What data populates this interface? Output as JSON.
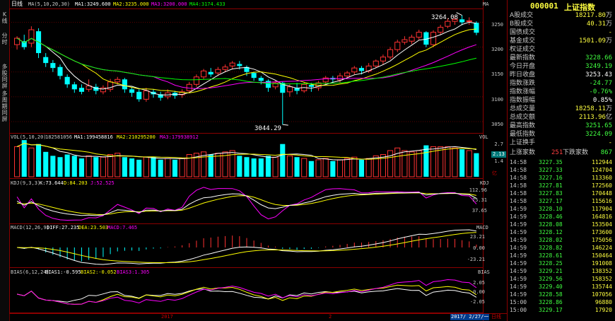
{
  "sidebar": {
    "tabs": [
      {
        "label": "K线",
        "active": true
      },
      {
        "label": "分时",
        "active": false
      },
      {
        "label": "多股同屏",
        "active": false
      },
      {
        "label": "多周期同屏",
        "active": false
      }
    ]
  },
  "main": {
    "period": "日线",
    "ma_legend": {
      "name": "MA(5,10,20,30)",
      "ma1": "MA1:3249.600",
      "ma2": "MA2:3235.000",
      "ma3": "MA3:3200.000",
      "ma4": "MA4:3174.433"
    },
    "price_axis": [
      "3250",
      "3200",
      "3150",
      "3100",
      "3050"
    ],
    "high_marker": "3264.08",
    "low_marker": "3044.29",
    "corner_label": "MA",
    "vol": {
      "name": "VOL(5,10,20)",
      "value": "182581056",
      "ma1": "MA1:199458816",
      "ma2": "MA2:210295200",
      "ma3": "MA3:179938912",
      "tag": "VOL",
      "axis": [
        "2.7",
        "1.4"
      ],
      "current": "2.13",
      "unit": "亿"
    },
    "kdj": {
      "name": "KDJ(9,3,3)",
      "k": "K:73.644",
      "d": "D:84.203",
      "j": "J:52.525",
      "tag": "KDJ",
      "axis": [
        "112.96",
        "75.31",
        "37.65"
      ]
    },
    "macd": {
      "name": "MACD(12,26,9)",
      "diff": "DIFF:27.235",
      "dea": "DEA:23.503",
      "macd": "MACD:7.465",
      "tag": "MACD",
      "axis": [
        "23.21",
        "0.00",
        "-23.21"
      ]
    },
    "bias": {
      "name": "BIAS(6,12,24)",
      "b1": "BIAS1:-0.595",
      "b2": "BIAS2:-0.052",
      "b3": "BIAS3:1.305",
      "tag": "BIAS",
      "axis": [
        "2.05",
        "0.00",
        "-2.05"
      ]
    },
    "xaxis": {
      "year": "2017",
      "month": "2",
      "date": "2017/ 2/27/一",
      "period_tag": "日线"
    }
  },
  "quote": {
    "code": "000001",
    "name": "上证指数",
    "rows": [
      {
        "label": "A股成交",
        "value": "18217.80",
        "unit": "万",
        "color": "#ffff40"
      },
      {
        "label": "B股成交",
        "value": "40.31",
        "unit": "万",
        "color": "#ffff40"
      },
      {
        "label": "国债成交",
        "value": "-",
        "unit": "",
        "color": "#ffff40"
      },
      {
        "label": "基金成交",
        "value": "1501.09",
        "unit": "万",
        "color": "#ffff40"
      },
      {
        "label": "权证成交",
        "value": "",
        "unit": "",
        "color": "#ffff40"
      },
      {
        "label": "最新指数",
        "value": "3228.66",
        "unit": "",
        "color": "#40ff40"
      },
      {
        "label": "今日开盘",
        "value": "3249.19",
        "unit": "",
        "color": "#40ff40"
      },
      {
        "label": "昨日收盘",
        "value": "3253.43",
        "unit": "",
        "color": "#ffffff"
      },
      {
        "label": "指数涨跌",
        "value": "-24.77",
        "unit": "",
        "color": "#40ff40"
      },
      {
        "label": "指数涨幅",
        "value": "-0.76%",
        "unit": "",
        "color": "#40ff40"
      },
      {
        "label": "指数振幅",
        "value": "0.85%",
        "unit": "",
        "color": "#ffffff"
      },
      {
        "label": "总成交量",
        "value": "18258.11",
        "unit": "万",
        "color": "#ffff40"
      },
      {
        "label": "总成交额",
        "value": "2113.96",
        "unit": "亿",
        "color": "#ffff40"
      },
      {
        "label": "最高指数",
        "value": "3251.65",
        "unit": "",
        "color": "#40ff40"
      },
      {
        "label": "最低指数",
        "value": "3224.09",
        "unit": "",
        "color": "#40ff40"
      },
      {
        "label": "上证换手",
        "value": "-",
        "unit": "",
        "color": "#ffff40"
      }
    ],
    "updown": {
      "up_label": "上涨家数",
      "up": "251",
      "down_label": "下跌家数",
      "down": "867"
    },
    "ticks": [
      {
        "time": "14:58",
        "price": "3227.35",
        "vol": "112944"
      },
      {
        "time": "14:58",
        "price": "3227.33",
        "vol": "124704"
      },
      {
        "time": "14:58",
        "price": "3227.16",
        "vol": "113360"
      },
      {
        "time": "14:58",
        "price": "3227.81",
        "vol": "172560"
      },
      {
        "time": "14:58",
        "price": "3227.83",
        "vol": "170448"
      },
      {
        "time": "14:58",
        "price": "3227.17",
        "vol": "115616"
      },
      {
        "time": "14:59",
        "price": "3228.10",
        "vol": "117904"
      },
      {
        "time": "14:59",
        "price": "3228.46",
        "vol": "164816"
      },
      {
        "time": "14:59",
        "price": "3228.08",
        "vol": "153504"
      },
      {
        "time": "14:59",
        "price": "3228.12",
        "vol": "173600"
      },
      {
        "time": "14:59",
        "price": "3228.02",
        "vol": "175056"
      },
      {
        "time": "14:59",
        "price": "3228.82",
        "vol": "146224"
      },
      {
        "time": "14:59",
        "price": "3228.61",
        "vol": "150464"
      },
      {
        "time": "14:59",
        "price": "3228.25",
        "vol": "191008"
      },
      {
        "time": "14:59",
        "price": "3229.21",
        "vol": "138352"
      },
      {
        "time": "14:59",
        "price": "3229.56",
        "vol": "158352"
      },
      {
        "time": "14:59",
        "price": "3229.40",
        "vol": "135744"
      },
      {
        "time": "14:59",
        "price": "3228.58",
        "vol": "107056"
      },
      {
        "time": "15:00",
        "price": "3228.86",
        "vol": "96880"
      },
      {
        "time": "15:00",
        "price": "3229.17",
        "vol": "17920"
      }
    ]
  },
  "chart_data": {
    "type": "candlestick",
    "price_range": [
      3030,
      3275
    ],
    "candles": [
      [
        3205,
        3218,
        3195,
        3222
      ],
      [
        3212,
        3200,
        3195,
        3225
      ],
      [
        3208,
        3235,
        3200,
        3242
      ],
      [
        3232,
        3188,
        3178,
        3238
      ],
      [
        3180,
        3168,
        3160,
        3188
      ],
      [
        3168,
        3158,
        3150,
        3174
      ],
      [
        3160,
        3142,
        3135,
        3165
      ],
      [
        3140,
        3125,
        3118,
        3145
      ],
      [
        3125,
        3115,
        3108,
        3130
      ],
      [
        3118,
        3110,
        3105,
        3125
      ],
      [
        3115,
        3122,
        3110,
        3135
      ],
      [
        3120,
        3112,
        3105,
        3126
      ],
      [
        3110,
        3118,
        3105,
        3123
      ],
      [
        3115,
        3130,
        3110,
        3136
      ],
      [
        3130,
        3135,
        3125,
        3140
      ],
      [
        3135,
        3115,
        3108,
        3138
      ],
      [
        3115,
        3108,
        3100,
        3120
      ],
      [
        3110,
        3095,
        3090,
        3115
      ],
      [
        3095,
        3112,
        3090,
        3118
      ],
      [
        3110,
        3105,
        3098,
        3115
      ],
      [
        3105,
        3098,
        3092,
        3110
      ],
      [
        3100,
        3108,
        3095,
        3115
      ],
      [
        3108,
        3102,
        3096,
        3112
      ],
      [
        3104,
        3110,
        3098,
        3115
      ],
      [
        3112,
        3125,
        3108,
        3130
      ],
      [
        3125,
        3140,
        3120,
        3145
      ],
      [
        3140,
        3152,
        3135,
        3156
      ],
      [
        3150,
        3145,
        3140,
        3158
      ],
      [
        3148,
        3155,
        3142,
        3160
      ],
      [
        3155,
        3160,
        3150,
        3165
      ],
      [
        3162,
        3168,
        3155,
        3172
      ],
      [
        3166,
        3162,
        3155,
        3172
      ],
      [
        3160,
        3150,
        3142,
        3163
      ],
      [
        3148,
        3138,
        3132,
        3150
      ],
      [
        3138,
        3132,
        3125,
        3142
      ],
      [
        3132,
        3118,
        3110,
        3135
      ],
      [
        3120,
        3128,
        3115,
        3132
      ],
      [
        3128,
        3108,
        3044,
        3130
      ],
      [
        3110,
        3120,
        3100,
        3125
      ],
      [
        3118,
        3112,
        3105,
        3128
      ],
      [
        3112,
        3125,
        3108,
        3130
      ],
      [
        3124,
        3120,
        3110,
        3128
      ],
      [
        3118,
        3128,
        3112,
        3132
      ],
      [
        3130,
        3138,
        3125,
        3142
      ],
      [
        3138,
        3135,
        3128,
        3142
      ],
      [
        3134,
        3142,
        3128,
        3148
      ],
      [
        3142,
        3148,
        3138,
        3152
      ],
      [
        3150,
        3158,
        3145,
        3162
      ],
      [
        3158,
        3152,
        3145,
        3162
      ],
      [
        3152,
        3162,
        3148,
        3168
      ],
      [
        3162,
        3172,
        3158,
        3175
      ],
      [
        3172,
        3180,
        3165,
        3185
      ],
      [
        3180,
        3195,
        3175,
        3200
      ],
      [
        3195,
        3210,
        3190,
        3215
      ],
      [
        3210,
        3215,
        3205,
        3222
      ],
      [
        3212,
        3220,
        3206,
        3225
      ],
      [
        3220,
        3230,
        3215,
        3235
      ],
      [
        3230,
        3205,
        3200,
        3232
      ],
      [
        3205,
        3230,
        3200,
        3234
      ],
      [
        3230,
        3240,
        3225,
        3245
      ],
      [
        3242,
        3252,
        3238,
        3258
      ],
      [
        3252,
        3256,
        3245,
        3262
      ],
      [
        3256,
        3250,
        3244,
        3264
      ],
      [
        3252,
        3253,
        3245,
        3260
      ],
      [
        3249,
        3229,
        3224,
        3252
      ]
    ],
    "ma_series_colors": [
      "#ffffff",
      "#ffff00",
      "#ff00ff",
      "#00ff00"
    ],
    "volume_range": [
      0,
      2.7
    ],
    "volume": [
      2.3,
      2.8,
      2.2,
      2.5,
      1.9,
      1.6,
      1.5,
      1.7,
      1.6,
      1.4,
      1.6,
      1.5,
      1.5,
      1.7,
      1.8,
      1.5,
      1.4,
      1.3,
      1.5,
      1.5,
      1.3,
      1.4,
      1.3,
      1.4,
      1.7,
      1.8,
      1.9,
      1.7,
      1.8,
      1.9,
      2.0,
      1.6,
      1.5,
      1.4,
      1.4,
      1.6,
      1.5,
      2.5,
      1.6,
      1.5,
      1.4,
      1.2,
      1.3,
      1.4,
      1.2,
      1.3,
      1.4,
      1.5,
      1.3,
      1.4,
      1.6,
      1.7,
      2.0,
      2.2,
      2.0,
      1.9,
      2.0,
      2.4,
      2.3,
      2.3,
      2.3,
      2.2,
      2.1,
      2.0,
      1.8
    ],
    "macd_range": [
      -30,
      30
    ],
    "bias_range": [
      -3,
      3.5
    ]
  }
}
